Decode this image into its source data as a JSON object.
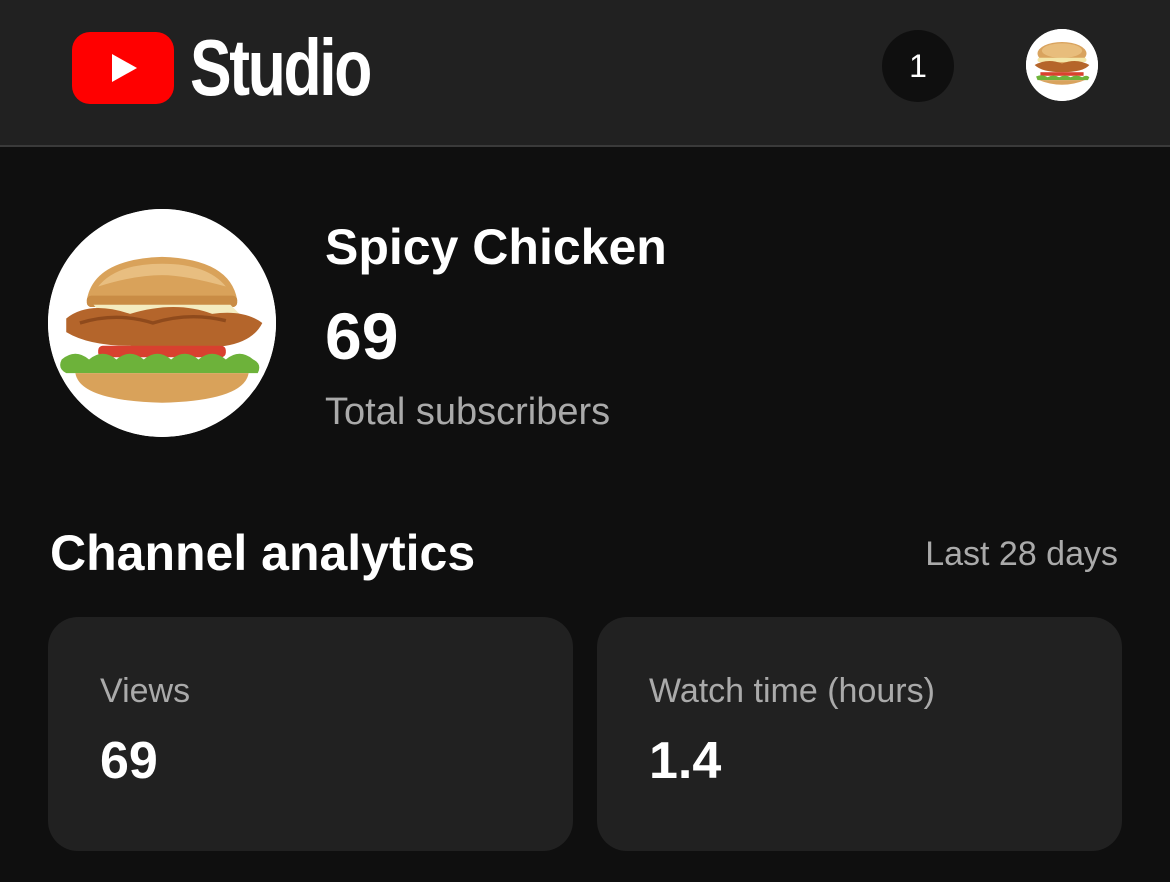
{
  "header": {
    "app_name": "Studio",
    "notification_count": "1",
    "logo_icon": "youtube-play-icon",
    "brand_color": "#ff0000"
  },
  "channel": {
    "name": "Spicy Chicken",
    "subscriber_count": "69",
    "subscriber_label": "Total subscribers",
    "avatar_icon": "chicken-sandwich-avatar"
  },
  "analytics": {
    "title": "Channel analytics",
    "range": "Last 28 days",
    "cards": [
      {
        "label": "Views",
        "value": "69"
      },
      {
        "label": "Watch time (hours)",
        "value": "1.4"
      }
    ]
  }
}
